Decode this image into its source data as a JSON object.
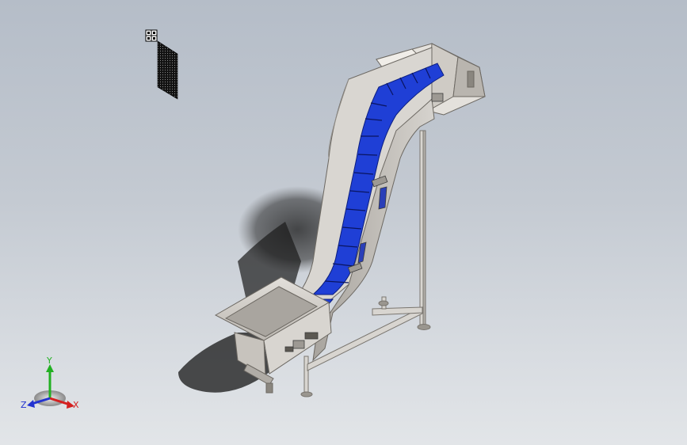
{
  "viewport": {
    "background_top": "#b5bdc8",
    "background_bottom": "#e2e5e8",
    "model": "inclined-cleated-belt-conveyor",
    "belt_color": "#1f3fd6",
    "frame_color": "#c9c6c0"
  },
  "triad": {
    "x_label": "X",
    "y_label": "Y",
    "z_label": "Z",
    "x_color": "#d42020",
    "y_color": "#22b022",
    "z_color": "#2233d0"
  },
  "icons": {
    "view_orientation": "four-panes-icon",
    "section_plane": "section-plane-icon"
  }
}
